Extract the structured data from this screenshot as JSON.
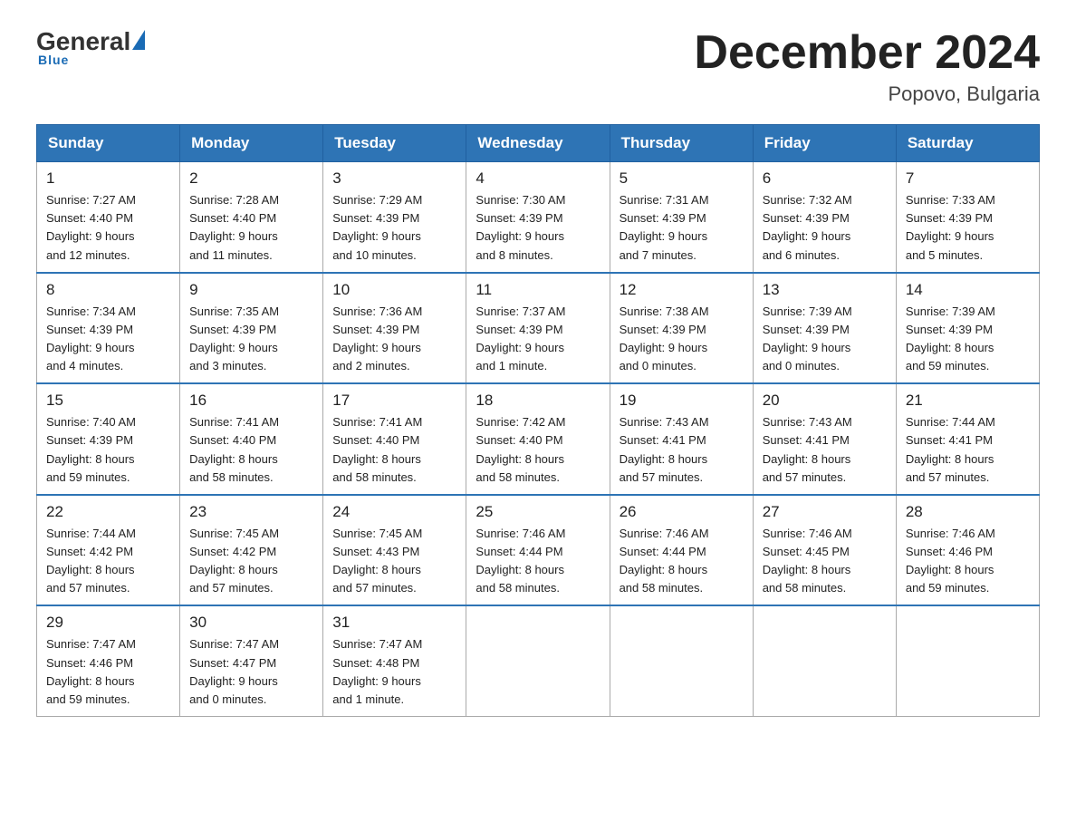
{
  "header": {
    "logo_general": "General",
    "logo_blue": "Blue",
    "month_title": "December 2024",
    "location": "Popovo, Bulgaria"
  },
  "days_of_week": [
    "Sunday",
    "Monday",
    "Tuesday",
    "Wednesday",
    "Thursday",
    "Friday",
    "Saturday"
  ],
  "weeks": [
    [
      {
        "day": "1",
        "sunrise": "7:27 AM",
        "sunset": "4:40 PM",
        "daylight": "9 hours and 12 minutes."
      },
      {
        "day": "2",
        "sunrise": "7:28 AM",
        "sunset": "4:40 PM",
        "daylight": "9 hours and 11 minutes."
      },
      {
        "day": "3",
        "sunrise": "7:29 AM",
        "sunset": "4:39 PM",
        "daylight": "9 hours and 10 minutes."
      },
      {
        "day": "4",
        "sunrise": "7:30 AM",
        "sunset": "4:39 PM",
        "daylight": "9 hours and 8 minutes."
      },
      {
        "day": "5",
        "sunrise": "7:31 AM",
        "sunset": "4:39 PM",
        "daylight": "9 hours and 7 minutes."
      },
      {
        "day": "6",
        "sunrise": "7:32 AM",
        "sunset": "4:39 PM",
        "daylight": "9 hours and 6 minutes."
      },
      {
        "day": "7",
        "sunrise": "7:33 AM",
        "sunset": "4:39 PM",
        "daylight": "9 hours and 5 minutes."
      }
    ],
    [
      {
        "day": "8",
        "sunrise": "7:34 AM",
        "sunset": "4:39 PM",
        "daylight": "9 hours and 4 minutes."
      },
      {
        "day": "9",
        "sunrise": "7:35 AM",
        "sunset": "4:39 PM",
        "daylight": "9 hours and 3 minutes."
      },
      {
        "day": "10",
        "sunrise": "7:36 AM",
        "sunset": "4:39 PM",
        "daylight": "9 hours and 2 minutes."
      },
      {
        "day": "11",
        "sunrise": "7:37 AM",
        "sunset": "4:39 PM",
        "daylight": "9 hours and 1 minute."
      },
      {
        "day": "12",
        "sunrise": "7:38 AM",
        "sunset": "4:39 PM",
        "daylight": "9 hours and 0 minutes."
      },
      {
        "day": "13",
        "sunrise": "7:39 AM",
        "sunset": "4:39 PM",
        "daylight": "9 hours and 0 minutes."
      },
      {
        "day": "14",
        "sunrise": "7:39 AM",
        "sunset": "4:39 PM",
        "daylight": "8 hours and 59 minutes."
      }
    ],
    [
      {
        "day": "15",
        "sunrise": "7:40 AM",
        "sunset": "4:39 PM",
        "daylight": "8 hours and 59 minutes."
      },
      {
        "day": "16",
        "sunrise": "7:41 AM",
        "sunset": "4:40 PM",
        "daylight": "8 hours and 58 minutes."
      },
      {
        "day": "17",
        "sunrise": "7:41 AM",
        "sunset": "4:40 PM",
        "daylight": "8 hours and 58 minutes."
      },
      {
        "day": "18",
        "sunrise": "7:42 AM",
        "sunset": "4:40 PM",
        "daylight": "8 hours and 58 minutes."
      },
      {
        "day": "19",
        "sunrise": "7:43 AM",
        "sunset": "4:41 PM",
        "daylight": "8 hours and 57 minutes."
      },
      {
        "day": "20",
        "sunrise": "7:43 AM",
        "sunset": "4:41 PM",
        "daylight": "8 hours and 57 minutes."
      },
      {
        "day": "21",
        "sunrise": "7:44 AM",
        "sunset": "4:41 PM",
        "daylight": "8 hours and 57 minutes."
      }
    ],
    [
      {
        "day": "22",
        "sunrise": "7:44 AM",
        "sunset": "4:42 PM",
        "daylight": "8 hours and 57 minutes."
      },
      {
        "day": "23",
        "sunrise": "7:45 AM",
        "sunset": "4:42 PM",
        "daylight": "8 hours and 57 minutes."
      },
      {
        "day": "24",
        "sunrise": "7:45 AM",
        "sunset": "4:43 PM",
        "daylight": "8 hours and 57 minutes."
      },
      {
        "day": "25",
        "sunrise": "7:46 AM",
        "sunset": "4:44 PM",
        "daylight": "8 hours and 58 minutes."
      },
      {
        "day": "26",
        "sunrise": "7:46 AM",
        "sunset": "4:44 PM",
        "daylight": "8 hours and 58 minutes."
      },
      {
        "day": "27",
        "sunrise": "7:46 AM",
        "sunset": "4:45 PM",
        "daylight": "8 hours and 58 minutes."
      },
      {
        "day": "28",
        "sunrise": "7:46 AM",
        "sunset": "4:46 PM",
        "daylight": "8 hours and 59 minutes."
      }
    ],
    [
      {
        "day": "29",
        "sunrise": "7:47 AM",
        "sunset": "4:46 PM",
        "daylight": "8 hours and 59 minutes."
      },
      {
        "day": "30",
        "sunrise": "7:47 AM",
        "sunset": "4:47 PM",
        "daylight": "9 hours and 0 minutes."
      },
      {
        "day": "31",
        "sunrise": "7:47 AM",
        "sunset": "4:48 PM",
        "daylight": "9 hours and 1 minute."
      },
      null,
      null,
      null,
      null
    ]
  ],
  "labels": {
    "sunrise": "Sunrise:",
    "sunset": "Sunset:",
    "daylight": "Daylight:"
  }
}
